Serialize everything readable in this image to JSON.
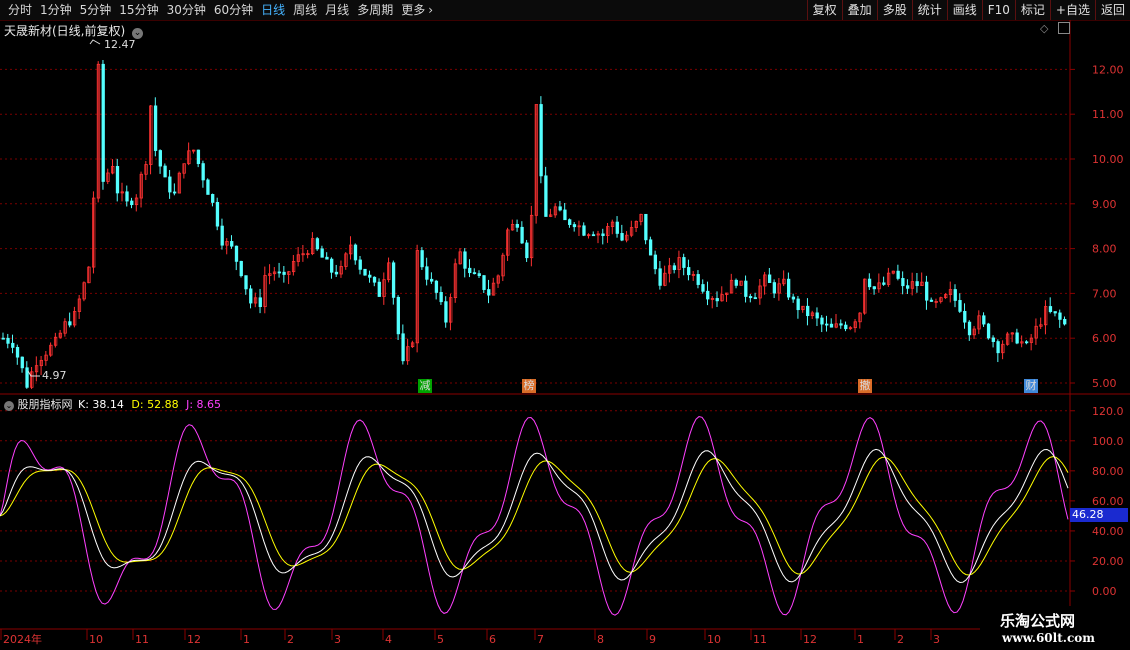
{
  "toolbar": {
    "periods": [
      "分时",
      "1分钟",
      "5分钟",
      "15分钟",
      "30分钟",
      "60分钟",
      "日线",
      "周线",
      "月线",
      "多周期",
      "更多"
    ],
    "active_period": "日线",
    "more_icon": "chevron-right-icon",
    "right_buttons": [
      "复权",
      "叠加",
      "多股",
      "统计",
      "画线",
      "F10",
      "标记",
      "+自选",
      "返回"
    ]
  },
  "main_chart": {
    "title": "天晟新材(日线,前复权)",
    "high_label": "12.47",
    "low_label": "4.97",
    "y_ticks": [
      "12.00",
      "11.00",
      "10.00",
      "9.00",
      "8.00",
      "7.00",
      "6.00",
      "5.00"
    ],
    "markers": [
      "减",
      "榜",
      "撤",
      "财"
    ],
    "marker_colors": [
      "#00c000",
      "#ff8030",
      "#ff8030",
      "#4aa0ff"
    ]
  },
  "indicator": {
    "name": "股朋指标网",
    "k_label": "K: 38.14",
    "d_label": "D: 52.88",
    "j_label": "J: 8.65",
    "y_ticks": [
      "120.0",
      "100.0",
      "80.00",
      "60.00",
      "40.00",
      "20.00",
      "0.00"
    ],
    "current_value": "46.28"
  },
  "x_axis": {
    "labels": [
      "2024年",
      "10",
      "11",
      "12",
      "1",
      "2",
      "3",
      "4",
      "5",
      "6",
      "7",
      "8",
      "9",
      "10",
      "11",
      "12",
      "1",
      "2",
      "3"
    ]
  },
  "watermark": {
    "line1": "乐淘公式网",
    "line2": "www.60lt.com"
  },
  "colors": {
    "up": "#ff3232",
    "down": "#54ffff",
    "k": "#ffffff",
    "d": "#ffff00",
    "j": "#ff40ff",
    "grid": "#7a0000"
  },
  "chart_data": {
    "type": "candlestick",
    "y_range": [
      4.8,
      12.6
    ],
    "close_path": [
      [
        0,
        6.0
      ],
      [
        4,
        5.9
      ],
      [
        8,
        5.3
      ],
      [
        10,
        4.97
      ],
      [
        14,
        5.5
      ],
      [
        18,
        5.7
      ],
      [
        22,
        5.9
      ],
      [
        26,
        6.3
      ],
      [
        30,
        6.5
      ],
      [
        34,
        7.2
      ],
      [
        37,
        7.8
      ],
      [
        39,
        10.5
      ],
      [
        40,
        12.0
      ],
      [
        41,
        9.4
      ],
      [
        43,
        9.6
      ],
      [
        46,
        9.9
      ],
      [
        48,
        9.3
      ],
      [
        52,
        9.0
      ],
      [
        56,
        9.2
      ],
      [
        60,
        10.0
      ],
      [
        62,
        11.2
      ],
      [
        64,
        10.2
      ],
      [
        68,
        9.5
      ],
      [
        72,
        9.2
      ],
      [
        76,
        10.0
      ],
      [
        80,
        10.2
      ],
      [
        84,
        9.6
      ],
      [
        88,
        9.0
      ],
      [
        92,
        8.2
      ],
      [
        96,
        8.0
      ],
      [
        100,
        7.5
      ],
      [
        104,
        6.8
      ],
      [
        108,
        6.8
      ],
      [
        110,
        7.4
      ],
      [
        114,
        7.5
      ],
      [
        118,
        7.3
      ],
      [
        122,
        7.7
      ],
      [
        126,
        7.9
      ],
      [
        130,
        8.1
      ],
      [
        134,
        7.8
      ],
      [
        138,
        7.5
      ],
      [
        142,
        7.5
      ],
      [
        146,
        8.1
      ],
      [
        150,
        7.6
      ],
      [
        154,
        7.3
      ],
      [
        158,
        7.0
      ],
      [
        162,
        7.8
      ],
      [
        166,
        6.1
      ],
      [
        168,
        5.4
      ],
      [
        172,
        6.0
      ],
      [
        174,
        7.9
      ],
      [
        178,
        7.4
      ],
      [
        182,
        7.0
      ],
      [
        186,
        6.4
      ],
      [
        190,
        7.6
      ],
      [
        192,
        7.9
      ],
      [
        196,
        7.4
      ],
      [
        200,
        7.3
      ],
      [
        204,
        7.0
      ],
      [
        208,
        7.4
      ],
      [
        212,
        8.4
      ],
      [
        216,
        8.6
      ],
      [
        220,
        7.9
      ],
      [
        222,
        8.7
      ],
      [
        224,
        11.3
      ],
      [
        226,
        9.5
      ],
      [
        228,
        8.7
      ],
      [
        232,
        8.9
      ],
      [
        236,
        8.6
      ],
      [
        240,
        8.6
      ],
      [
        244,
        8.4
      ],
      [
        248,
        8.4
      ],
      [
        252,
        8.3
      ],
      [
        256,
        8.6
      ],
      [
        260,
        8.2
      ],
      [
        264,
        8.4
      ],
      [
        268,
        8.7
      ],
      [
        272,
        7.8
      ],
      [
        276,
        7.3
      ],
      [
        280,
        7.5
      ],
      [
        284,
        7.7
      ],
      [
        288,
        7.5
      ],
      [
        292,
        7.3
      ],
      [
        296,
        7.0
      ],
      [
        300,
        6.9
      ],
      [
        304,
        7.1
      ],
      [
        308,
        7.3
      ],
      [
        312,
        7.0
      ],
      [
        316,
        7.0
      ],
      [
        320,
        7.3
      ],
      [
        324,
        7.1
      ],
      [
        328,
        7.2
      ],
      [
        332,
        6.8
      ],
      [
        336,
        6.6
      ],
      [
        340,
        6.5
      ],
      [
        344,
        6.3
      ],
      [
        348,
        6.2
      ],
      [
        352,
        6.3
      ],
      [
        356,
        6.3
      ],
      [
        360,
        6.6
      ],
      [
        362,
        7.4
      ],
      [
        366,
        7.1
      ],
      [
        370,
        7.2
      ],
      [
        374,
        7.5
      ],
      [
        378,
        7.1
      ],
      [
        382,
        7.2
      ],
      [
        386,
        7.2
      ],
      [
        390,
        6.7
      ],
      [
        394,
        6.8
      ],
      [
        398,
        7.0
      ],
      [
        402,
        6.7
      ],
      [
        406,
        6.2
      ],
      [
        410,
        6.4
      ],
      [
        414,
        6.1
      ],
      [
        418,
        5.8
      ],
      [
        422,
        6.0
      ],
      [
        426,
        6.0
      ],
      [
        430,
        5.8
      ],
      [
        434,
        6.2
      ],
      [
        438,
        6.6
      ],
      [
        442,
        6.5
      ],
      [
        446,
        6.3
      ]
    ],
    "kdj_series": [
      "K",
      "D",
      "J"
    ]
  }
}
